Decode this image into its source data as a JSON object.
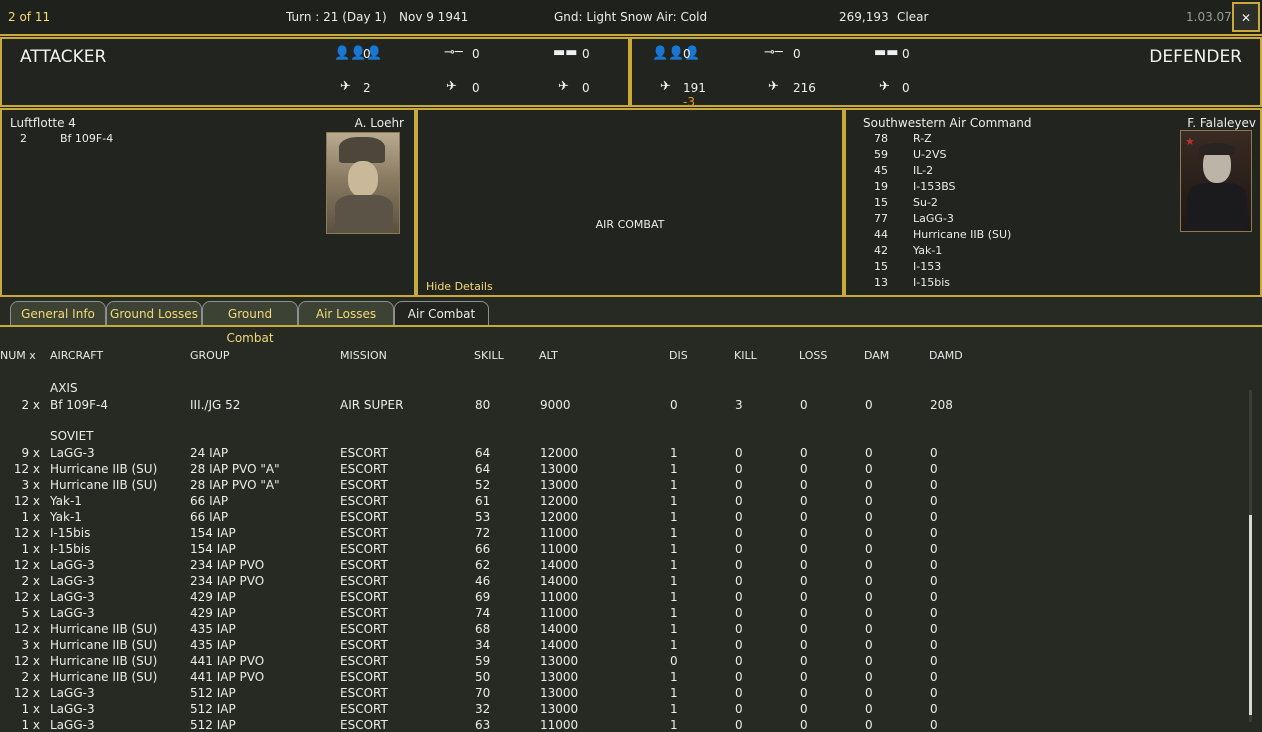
{
  "topbar": {
    "page": "2 of 11",
    "turn": "Turn : 21 (Day 1)",
    "date": "Nov 9 1941",
    "weather": "Gnd: Light Snow  Air: Cold",
    "coords": "269,193",
    "sky": "Clear",
    "version": "1.03.07",
    "close_label": "✕"
  },
  "attacker": {
    "title": "ATTACKER",
    "men": "0",
    "guns": "0",
    "tanks": "0",
    "fighters": "2",
    "bombers": "0",
    "recon": "0"
  },
  "defender": {
    "title": "DEFENDER",
    "men": "0",
    "guns": "0",
    "tanks": "0",
    "fighters": "191",
    "fighters_delta": "-3",
    "bombers": "216",
    "recon": "0"
  },
  "attacker_cmd": {
    "name": "Luftflotte 4",
    "commander": "A. Loehr",
    "units": [
      {
        "count": "2",
        "type": "Bf 109F-4"
      }
    ]
  },
  "center": {
    "label": "AIR COMBAT",
    "hide_details": "Hide Details"
  },
  "defender_cmd": {
    "name": "Southwestern Air Command",
    "commander": "F. Falaleyev",
    "units": [
      {
        "count": "78",
        "type": "R-Z"
      },
      {
        "count": "59",
        "type": "U-2VS"
      },
      {
        "count": "45",
        "type": "IL-2"
      },
      {
        "count": "19",
        "type": "I-153BS"
      },
      {
        "count": "15",
        "type": "Su-2"
      },
      {
        "count": "77",
        "type": "LaGG-3"
      },
      {
        "count": "44",
        "type": "Hurricane IIB (SU)"
      },
      {
        "count": "42",
        "type": "Yak-1"
      },
      {
        "count": "15",
        "type": "I-153"
      },
      {
        "count": "13",
        "type": "I-15bis"
      }
    ]
  },
  "tabs": [
    "General Info",
    "Ground Losses",
    "Ground Combat",
    "Air Losses",
    "Air Combat"
  ],
  "active_tab": "Air Combat",
  "columns": [
    "NUM x",
    "AIRCRAFT",
    "GROUP",
    "MISSION",
    "SKILL",
    "ALT",
    "DIS",
    "KILL",
    "LOSS",
    "DAM",
    "DAMD"
  ],
  "axis_label": "AXIS",
  "soviet_label": "SOVIET",
  "axis_rows": [
    {
      "num": "2 x",
      "aircraft": "Bf 109F-4",
      "group": "III./JG 52",
      "mission": "AIR SUPER",
      "skill": "80",
      "alt": "9000",
      "dis": "0",
      "kill": "3",
      "loss": "0",
      "dam": "0",
      "damd": "208"
    }
  ],
  "soviet_rows": [
    {
      "num": "9 x",
      "aircraft": "LaGG-3",
      "group": "24 IAP",
      "mission": "ESCORT",
      "skill": "64",
      "alt": "12000",
      "dis": "1",
      "kill": "0",
      "loss": "0",
      "dam": "0",
      "damd": "0"
    },
    {
      "num": "12 x",
      "aircraft": "Hurricane IIB (SU)",
      "group": "28 IAP PVO \"A\"",
      "mission": "ESCORT",
      "skill": "64",
      "alt": "13000",
      "dis": "1",
      "kill": "0",
      "loss": "0",
      "dam": "0",
      "damd": "0"
    },
    {
      "num": "3 x",
      "aircraft": "Hurricane IIB (SU)",
      "group": "28 IAP PVO \"A\"",
      "mission": "ESCORT",
      "skill": "52",
      "alt": "13000",
      "dis": "1",
      "kill": "0",
      "loss": "0",
      "dam": "0",
      "damd": "0"
    },
    {
      "num": "12 x",
      "aircraft": "Yak-1",
      "group": "66 IAP",
      "mission": "ESCORT",
      "skill": "61",
      "alt": "12000",
      "dis": "1",
      "kill": "0",
      "loss": "0",
      "dam": "0",
      "damd": "0"
    },
    {
      "num": "1 x",
      "aircraft": "Yak-1",
      "group": "66 IAP",
      "mission": "ESCORT",
      "skill": "53",
      "alt": "12000",
      "dis": "1",
      "kill": "0",
      "loss": "0",
      "dam": "0",
      "damd": "0"
    },
    {
      "num": "12 x",
      "aircraft": "I-15bis",
      "group": "154 IAP",
      "mission": "ESCORT",
      "skill": "72",
      "alt": "11000",
      "dis": "1",
      "kill": "0",
      "loss": "0",
      "dam": "0",
      "damd": "0"
    },
    {
      "num": "1 x",
      "aircraft": "I-15bis",
      "group": "154 IAP",
      "mission": "ESCORT",
      "skill": "66",
      "alt": "11000",
      "dis": "1",
      "kill": "0",
      "loss": "0",
      "dam": "0",
      "damd": "0"
    },
    {
      "num": "12 x",
      "aircraft": "LaGG-3",
      "group": "234 IAP PVO",
      "mission": "ESCORT",
      "skill": "62",
      "alt": "14000",
      "dis": "1",
      "kill": "0",
      "loss": "0",
      "dam": "0",
      "damd": "0"
    },
    {
      "num": "2 x",
      "aircraft": "LaGG-3",
      "group": "234 IAP PVO",
      "mission": "ESCORT",
      "skill": "46",
      "alt": "14000",
      "dis": "1",
      "kill": "0",
      "loss": "0",
      "dam": "0",
      "damd": "0"
    },
    {
      "num": "12 x",
      "aircraft": "LaGG-3",
      "group": "429 IAP",
      "mission": "ESCORT",
      "skill": "69",
      "alt": "11000",
      "dis": "1",
      "kill": "0",
      "loss": "0",
      "dam": "0",
      "damd": "0"
    },
    {
      "num": "5 x",
      "aircraft": "LaGG-3",
      "group": "429 IAP",
      "mission": "ESCORT",
      "skill": "74",
      "alt": "11000",
      "dis": "1",
      "kill": "0",
      "loss": "0",
      "dam": "0",
      "damd": "0"
    },
    {
      "num": "12 x",
      "aircraft": "Hurricane IIB (SU)",
      "group": "435 IAP",
      "mission": "ESCORT",
      "skill": "68",
      "alt": "14000",
      "dis": "1",
      "kill": "0",
      "loss": "0",
      "dam": "0",
      "damd": "0"
    },
    {
      "num": "3 x",
      "aircraft": "Hurricane IIB (SU)",
      "group": "435 IAP",
      "mission": "ESCORT",
      "skill": "34",
      "alt": "14000",
      "dis": "1",
      "kill": "0",
      "loss": "0",
      "dam": "0",
      "damd": "0"
    },
    {
      "num": "12 x",
      "aircraft": "Hurricane IIB (SU)",
      "group": "441 IAP PVO",
      "mission": "ESCORT",
      "skill": "59",
      "alt": "13000",
      "dis": "0",
      "kill": "0",
      "loss": "0",
      "dam": "0",
      "damd": "0"
    },
    {
      "num": "2 x",
      "aircraft": "Hurricane IIB (SU)",
      "group": "441 IAP PVO",
      "mission": "ESCORT",
      "skill": "50",
      "alt": "13000",
      "dis": "1",
      "kill": "0",
      "loss": "0",
      "dam": "0",
      "damd": "0"
    },
    {
      "num": "12 x",
      "aircraft": "LaGG-3",
      "group": "512 IAP",
      "mission": "ESCORT",
      "skill": "70",
      "alt": "13000",
      "dis": "1",
      "kill": "0",
      "loss": "0",
      "dam": "0",
      "damd": "0"
    },
    {
      "num": "1 x",
      "aircraft": "LaGG-3",
      "group": "512 IAP",
      "mission": "ESCORT",
      "skill": "32",
      "alt": "13000",
      "dis": "1",
      "kill": "0",
      "loss": "0",
      "dam": "0",
      "damd": "0"
    },
    {
      "num": "1 x",
      "aircraft": "LaGG-3",
      "group": "512 IAP",
      "mission": "ESCORT",
      "skill": "63",
      "alt": "11000",
      "dis": "1",
      "kill": "0",
      "loss": "0",
      "dam": "0",
      "damd": "0"
    }
  ],
  "colors": {
    "accent": "#c9a93a",
    "tab_text": "#f4da76",
    "background": "#262a22"
  },
  "icons": [
    "close-icon",
    "infantry-icon",
    "artillery-icon",
    "tank-icon",
    "fighter-icon",
    "bomber-icon",
    "recon-plane-icon"
  ]
}
